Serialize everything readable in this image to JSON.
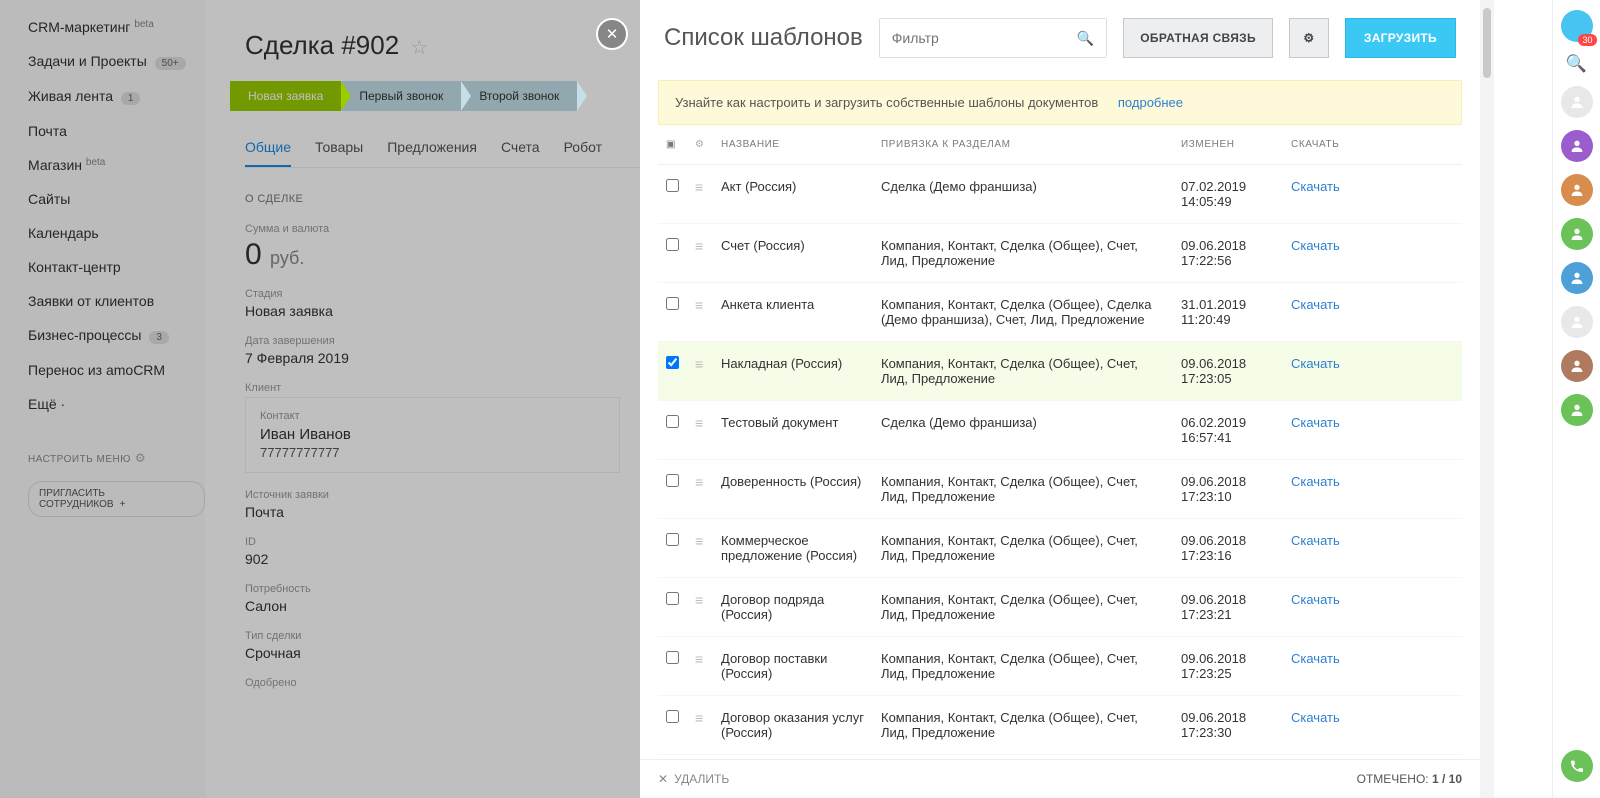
{
  "nav": {
    "items": [
      {
        "label": "CRM-маркетинг",
        "badge": "beta",
        "beta": true
      },
      {
        "label": "Задачи и Проекты",
        "badge": "50+"
      },
      {
        "label": "Живая лента",
        "badge": "1"
      },
      {
        "label": "Почта"
      },
      {
        "label": "Магазин",
        "badge": "beta",
        "beta": true
      },
      {
        "label": "Сайты"
      },
      {
        "label": "Календарь"
      },
      {
        "label": "Контакт-центр"
      },
      {
        "label": "Заявки от клиентов"
      },
      {
        "label": "Бизнес-процессы",
        "badge": "3"
      },
      {
        "label": "Перенос из amoCRM"
      },
      {
        "label": "Ещё ·"
      }
    ],
    "configure": "НАСТРОИТЬ МЕНЮ",
    "invite": "ПРИГЛАСИТЬ СОТРУДНИКОВ"
  },
  "deal": {
    "title": "Сделка #902",
    "stages": [
      "Новая заявка",
      "Первый звонок",
      "Второй звонок"
    ],
    "tabs": [
      "Общие",
      "Товары",
      "Предложения",
      "Счета",
      "Робот"
    ],
    "section_about": "О СДЕЛКЕ",
    "fields": {
      "sum_label": "Сумма и валюта",
      "sum_value": "0",
      "sum_cur": "руб.",
      "stage_label": "Стадия",
      "stage_value": "Новая заявка",
      "end_label": "Дата завершения",
      "end_value": "7 Февраля 2019",
      "client_label": "Клиент",
      "contact_label": "Контакт",
      "contact_name": "Иван Иванов",
      "contact_phone": "77777777777",
      "source_label": "Источник заявки",
      "source_value": "Почта",
      "id_label": "ID",
      "id_value": "902",
      "need_label": "Потребность",
      "need_value": "Салон",
      "type_label": "Тип сделки",
      "type_value": "Срочная",
      "approved_label": "Одобрено"
    }
  },
  "panel": {
    "title": "Список шаблонов",
    "filter_placeholder": "Фильтр",
    "btn_feedback": "ОБРАТНАЯ СВЯЗЬ",
    "btn_upload": "ЗАГРУЗИТЬ",
    "notice_text": "Узнайте как настроить и загрузить собственные шаблоны документов",
    "notice_link": "подробнее",
    "cols": {
      "name": "НАЗВАНИЕ",
      "bind": "ПРИВЯЗКА К РАЗДЕЛАМ",
      "changed": "ИЗМЕНЕН",
      "download": "СКАЧАТЬ"
    },
    "download_label": "Скачать",
    "rows": [
      {
        "name": "Акт (Россия)",
        "bind": "Сделка (Демо франшиза)",
        "date": "07.02.2019 14:05:49",
        "checked": false
      },
      {
        "name": "Счет (Россия)",
        "bind": "Компания, Контакт, Сделка (Общее), Счет, Лид, Предложение",
        "date": "09.06.2018 17:22:56",
        "checked": false
      },
      {
        "name": "Анкета клиента",
        "bind": "Компания, Контакт, Сделка (Общее), Сделка (Демо франшиза), Счет, Лид, Предложение",
        "date": "31.01.2019 11:20:49",
        "checked": false
      },
      {
        "name": "Накладная (Россия)",
        "bind": "Компания, Контакт, Сделка (Общее), Счет, Лид, Предложение",
        "date": "09.06.2018 17:23:05",
        "checked": true
      },
      {
        "name": "Тестовый документ",
        "bind": "Сделка (Демо франшиза)",
        "date": "06.02.2019 16:57:41",
        "checked": false
      },
      {
        "name": "Доверенность (Россия)",
        "bind": "Компания, Контакт, Сделка (Общее), Счет, Лид, Предложение",
        "date": "09.06.2018 17:23:10",
        "checked": false
      },
      {
        "name": "Коммерческое предложение (Россия)",
        "bind": "Компания, Контакт, Сделка (Общее), Счет, Лид, Предложение",
        "date": "09.06.2018 17:23:16",
        "checked": false
      },
      {
        "name": "Договор подряда (Россия)",
        "bind": "Компания, Контакт, Сделка (Общее), Счет, Лид, Предложение",
        "date": "09.06.2018 17:23:21",
        "checked": false
      },
      {
        "name": "Договор поставки (Россия)",
        "bind": "Компания, Контакт, Сделка (Общее), Счет, Лид, Предложение",
        "date": "09.06.2018 17:23:25",
        "checked": false
      },
      {
        "name": "Договор оказания услуг (Россия)",
        "bind": "Компания, Контакт, Сделка (Общее), Счет, Лид, Предложение",
        "date": "09.06.2018 17:23:30",
        "checked": false
      }
    ],
    "footer_delete": "УДАЛИТЬ",
    "footer_count_label": "ОТМЕЧЕНО:",
    "footer_count": "1 / 10"
  },
  "rightbar": {
    "badge": "30"
  }
}
